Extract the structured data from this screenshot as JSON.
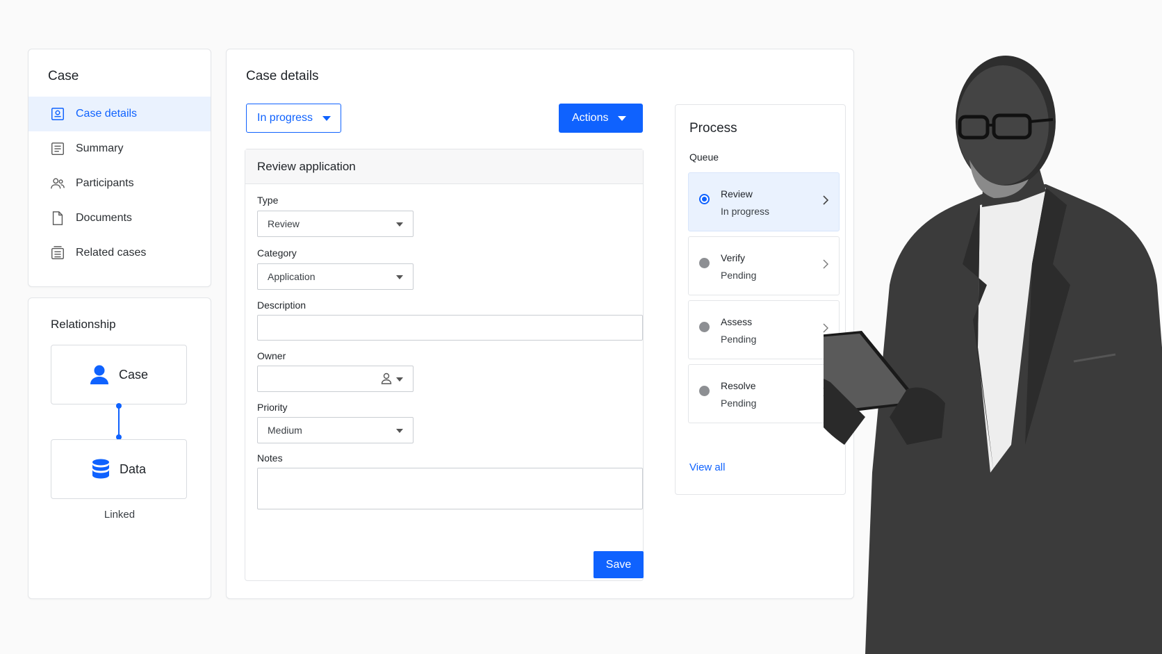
{
  "sidebar": {
    "title": "Case",
    "items": [
      {
        "label": "Case details",
        "icon": "case-details-icon",
        "active": true
      },
      {
        "label": "Summary",
        "icon": "summary-icon"
      },
      {
        "label": "Participants",
        "icon": "participants-icon"
      },
      {
        "label": "Documents",
        "icon": "document-icon"
      },
      {
        "label": "Related cases",
        "icon": "related-cases-icon"
      }
    ]
  },
  "relationship": {
    "title": "Relationship",
    "top_node": {
      "label": "Case",
      "icon": "person-icon"
    },
    "bottom_node": {
      "label": "Data",
      "icon": "database-icon"
    },
    "link_label": "Linked"
  },
  "main": {
    "title": "Case details",
    "status": "In progress",
    "actions_label": "Actions",
    "form": {
      "title": "Review application",
      "type_label": "Type",
      "type_value": "Review",
      "category_label": "Category",
      "category_value": "Application",
      "description_label": "Description",
      "description_value": "",
      "owner_label": "Owner",
      "owner_value": "",
      "priority_label": "Priority",
      "priority_value": "Medium",
      "notes_label": "Notes",
      "notes_value": "",
      "save_label": "Save"
    }
  },
  "process": {
    "title": "Process",
    "queue_label": "Queue",
    "steps": [
      {
        "name": "Review",
        "status": "In progress",
        "active": true
      },
      {
        "name": "Verify",
        "status": "Pending"
      },
      {
        "name": "Assess",
        "status": "Pending"
      },
      {
        "name": "Resolve",
        "status": "Pending"
      }
    ],
    "view_all": "View all"
  },
  "colors": {
    "accent": "#0f62fe",
    "active_bg": "#eaf2fe",
    "pending_dot": "#8d8f93"
  }
}
